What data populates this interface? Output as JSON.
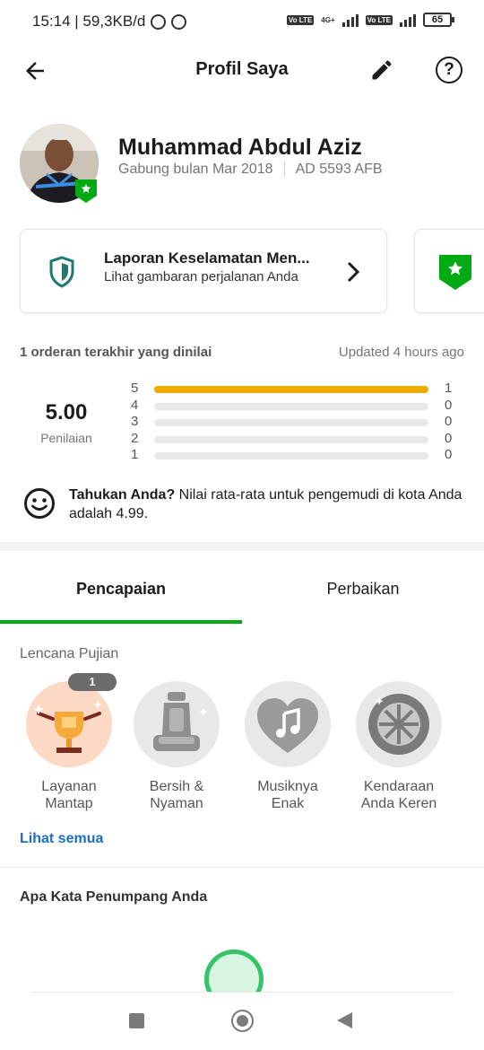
{
  "status_bar": {
    "time_speed": "15:14 | 59,3KB/d",
    "volte_1": "Vo LTE",
    "network": "4G+",
    "volte_2": "Vo LTE",
    "battery": "65"
  },
  "header": {
    "title": "Profil Saya",
    "back_icon": "arrow-left-icon",
    "edit_icon": "pencil-icon",
    "help_icon": "question-icon",
    "help_glyph": "?"
  },
  "profile": {
    "name": "Muhammad Abdul Aziz",
    "joined": "Gabung bulan Mar 2018",
    "plate": "AD 5593 AFB"
  },
  "safety_card": {
    "title": "Laporan Keselamatan Men...",
    "subtitle": "Lihat gambaran perjalanan Anda"
  },
  "ratings": {
    "header": "1 orderan terakhir yang dinilai",
    "updated": "Updated 4 hours ago",
    "score": "5.00",
    "score_label": "Penilaian",
    "rows": [
      {
        "star": "5",
        "count": "1",
        "fraction": 1.0
      },
      {
        "star": "4",
        "count": "0",
        "fraction": 0
      },
      {
        "star": "3",
        "count": "0",
        "fraction": 0
      },
      {
        "star": "2",
        "count": "0",
        "fraction": 0
      },
      {
        "star": "1",
        "count": "0",
        "fraction": 0
      }
    ],
    "bar_color": "#f0ab00"
  },
  "tip": {
    "bold": "Tahukan Anda?",
    "text": " Nilai rata-rata untuk pengemudi di kota Anda adalah 4.99."
  },
  "tabs": {
    "items": [
      "Pencapaian",
      "Perbaikan"
    ],
    "active": "Pencapaian",
    "accent": "#00aa13"
  },
  "badges": {
    "title": "Lencana Pujian",
    "count": "1",
    "items": [
      {
        "label": "Layanan Mantap",
        "icon": "trophy-icon"
      },
      {
        "label": "Bersih & Nyaman",
        "icon": "car-seat-icon"
      },
      {
        "label": "Musiknya Enak",
        "icon": "music-heart-icon"
      },
      {
        "label": "Kendaraan Anda Keren",
        "icon": "wheel-icon"
      }
    ],
    "see_all": "Lihat semua"
  },
  "passenger": {
    "title": "Apa Kata Penumpang Anda"
  }
}
